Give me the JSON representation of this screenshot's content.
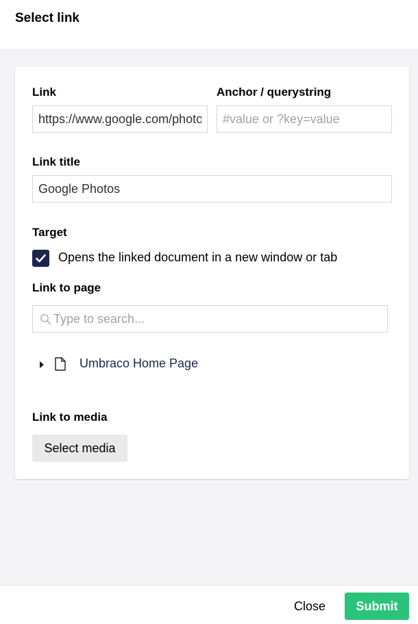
{
  "header": {
    "title": "Select link"
  },
  "form": {
    "link": {
      "label": "Link",
      "value": "https://www.google.com/photos"
    },
    "anchor": {
      "label": "Anchor / querystring",
      "placeholder": "#value or ?key=value",
      "value": ""
    },
    "link_title": {
      "label": "Link title",
      "value": "Google Photos"
    },
    "target": {
      "label": "Target",
      "checkbox_label": "Opens the linked document in a new window or tab",
      "checked": true
    },
    "link_to_page": {
      "label": "Link to page",
      "search_placeholder": "Type to search...",
      "tree_items": [
        {
          "label": "Umbraco Home Page",
          "icon": "document-icon"
        }
      ]
    },
    "link_to_media": {
      "label": "Link to media",
      "button_label": "Select media"
    }
  },
  "footer": {
    "close_label": "Close",
    "submit_label": "Submit"
  },
  "colors": {
    "accent_navy": "#1b264f",
    "submit_green": "#2bc37c",
    "panel_background": "#f3f3f5"
  }
}
